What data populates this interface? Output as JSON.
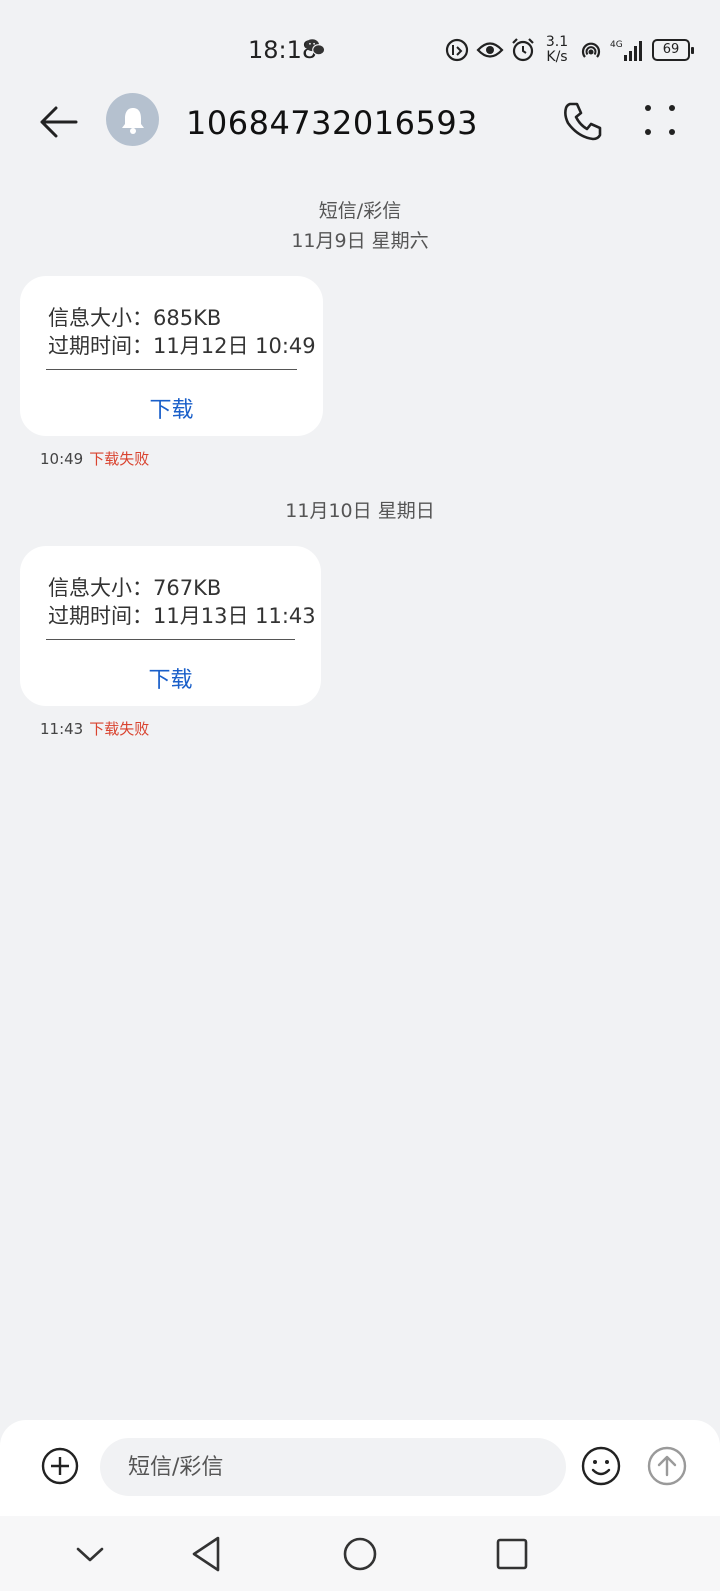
{
  "status_bar": {
    "time": "18:18",
    "net_speed_value": "3.1",
    "net_speed_unit": "K/s",
    "network_type": "4G",
    "battery_level": "69",
    "icons": [
      "wechat-icon",
      "eye-comfort-icon",
      "alarm-icon",
      "hotspot-icon",
      "signal-icon",
      "battery-icon"
    ]
  },
  "header": {
    "contact_number": "10684732016593",
    "icons": [
      "back-arrow-icon",
      "bell-icon",
      "phone-icon",
      "more-icon"
    ]
  },
  "thread": {
    "channel_label": "短信/彩信",
    "groups": [
      {
        "date": "11月9日 星期六",
        "message": {
          "size_label": "信息大小：",
          "size_value": "685KB",
          "expiry_label": "过期时间：",
          "expiry_value": "11月12日 10:49",
          "download_label": "下载",
          "time": "10:49",
          "status": "下载失败"
        }
      },
      {
        "date": "11月10日 星期日",
        "message": {
          "size_label": "信息大小：",
          "size_value": "767KB",
          "expiry_label": "过期时间：",
          "expiry_value": "11月13日 11:43",
          "download_label": "下载",
          "time": "11:43",
          "status": "下载失败"
        }
      }
    ]
  },
  "input_bar": {
    "placeholder": "短信/彩信",
    "value": ""
  },
  "nav_bar": {
    "icons": [
      "collapse-chevron-icon",
      "nav-back-icon",
      "nav-home-icon",
      "nav-recents-icon"
    ]
  },
  "colors": {
    "background": "#f1f2f4",
    "bubble": "#ffffff",
    "download_link": "#1a5fc9",
    "failed_status": "#d9432f",
    "avatar": "#b5c1cf"
  }
}
